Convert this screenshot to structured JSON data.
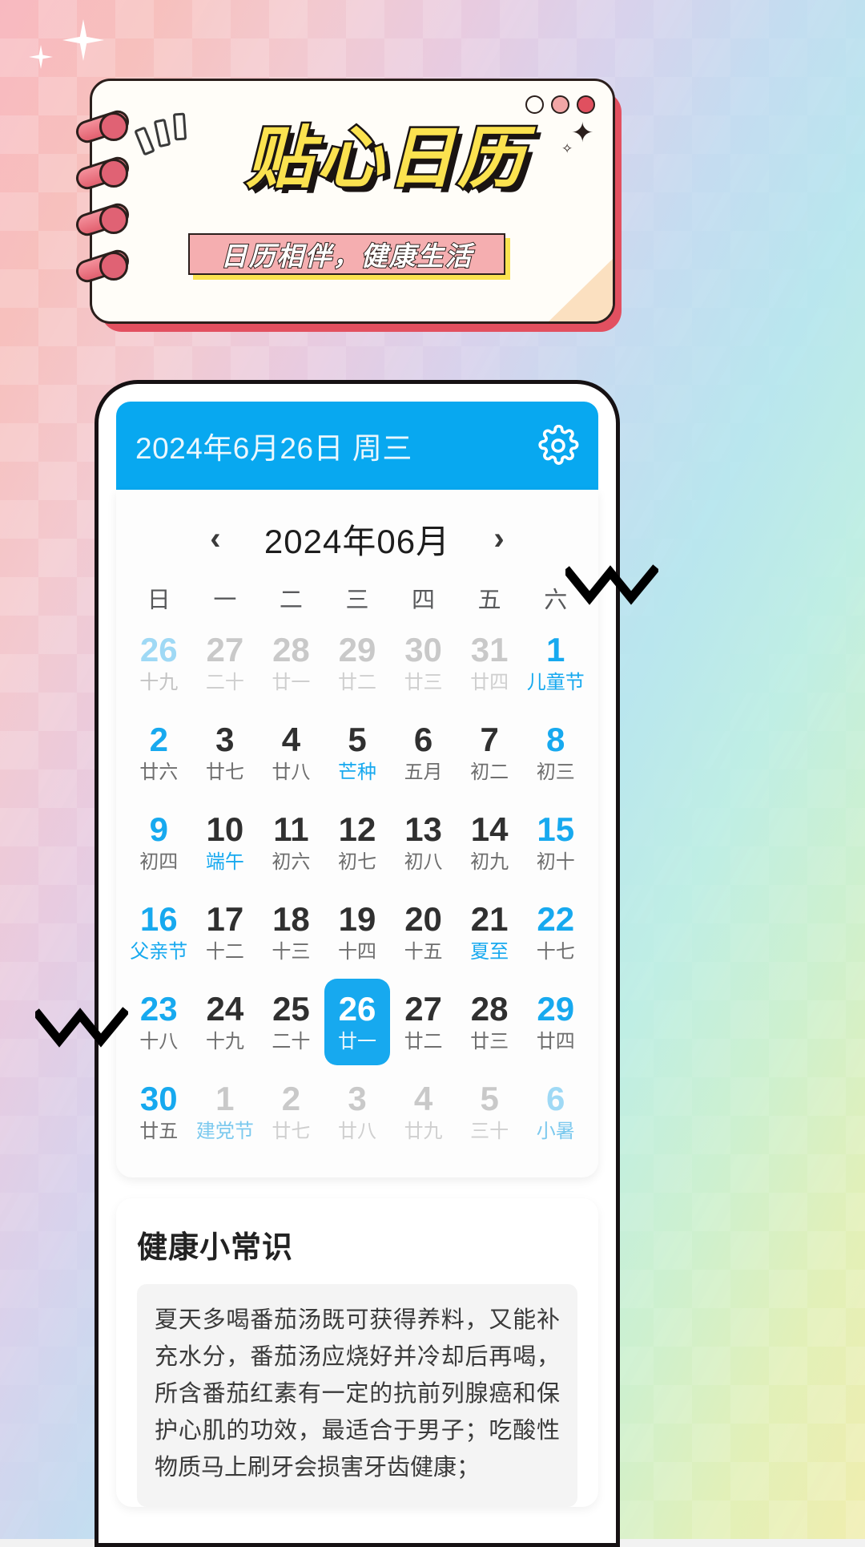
{
  "poster": {
    "title": "贴心日历",
    "subtitle": "日历相伴，健康生活",
    "dots": [
      "window-dot-1",
      "window-dot-2",
      "window-dot-3"
    ],
    "accent_yellow": "#FBE24F",
    "accent_pink": "#F5AEB0",
    "outline": "#2B1F1C"
  },
  "app": {
    "brand_blue": "#08A8F0",
    "header": {
      "date_text": "2024年6月26日 周三",
      "settings_icon": "gear-icon"
    },
    "calendar": {
      "prev_label": "‹",
      "next_label": "›",
      "month_label": "2024年06月",
      "weekdays": [
        "日",
        "一",
        "二",
        "三",
        "四",
        "五",
        "六"
      ],
      "selected_day": 26,
      "weeks": [
        [
          {
            "day": "26",
            "lunar": "十九",
            "state": "out",
            "blue": true
          },
          {
            "day": "27",
            "lunar": "二十",
            "state": "out"
          },
          {
            "day": "28",
            "lunar": "廿一",
            "state": "out"
          },
          {
            "day": "29",
            "lunar": "廿二",
            "state": "out"
          },
          {
            "day": "30",
            "lunar": "廿三",
            "state": "out"
          },
          {
            "day": "31",
            "lunar": "廿四",
            "state": "out"
          },
          {
            "day": "1",
            "lunar": "儿童节",
            "state": "in",
            "weekend": true,
            "festival": true
          }
        ],
        [
          {
            "day": "2",
            "lunar": "廿六",
            "state": "in",
            "weekend": true
          },
          {
            "day": "3",
            "lunar": "廿七",
            "state": "in"
          },
          {
            "day": "4",
            "lunar": "廿八",
            "state": "in"
          },
          {
            "day": "5",
            "lunar": "芒种",
            "state": "in",
            "festival": true
          },
          {
            "day": "6",
            "lunar": "五月",
            "state": "in"
          },
          {
            "day": "7",
            "lunar": "初二",
            "state": "in"
          },
          {
            "day": "8",
            "lunar": "初三",
            "state": "in",
            "weekend": true
          }
        ],
        [
          {
            "day": "9",
            "lunar": "初四",
            "state": "in",
            "weekend": true
          },
          {
            "day": "10",
            "lunar": "端午",
            "state": "in",
            "festival": true
          },
          {
            "day": "11",
            "lunar": "初六",
            "state": "in"
          },
          {
            "day": "12",
            "lunar": "初七",
            "state": "in"
          },
          {
            "day": "13",
            "lunar": "初八",
            "state": "in"
          },
          {
            "day": "14",
            "lunar": "初九",
            "state": "in"
          },
          {
            "day": "15",
            "lunar": "初十",
            "state": "in",
            "weekend": true
          }
        ],
        [
          {
            "day": "16",
            "lunar": "父亲节",
            "state": "in",
            "weekend": true,
            "festival": true
          },
          {
            "day": "17",
            "lunar": "十二",
            "state": "in"
          },
          {
            "day": "18",
            "lunar": "十三",
            "state": "in"
          },
          {
            "day": "19",
            "lunar": "十四",
            "state": "in"
          },
          {
            "day": "20",
            "lunar": "十五",
            "state": "in"
          },
          {
            "day": "21",
            "lunar": "夏至",
            "state": "in",
            "festival": true
          },
          {
            "day": "22",
            "lunar": "十七",
            "state": "in",
            "weekend": true
          }
        ],
        [
          {
            "day": "23",
            "lunar": "十八",
            "state": "in",
            "weekend": true
          },
          {
            "day": "24",
            "lunar": "十九",
            "state": "in"
          },
          {
            "day": "25",
            "lunar": "二十",
            "state": "in"
          },
          {
            "day": "26",
            "lunar": "廿一",
            "state": "in",
            "selected": true
          },
          {
            "day": "27",
            "lunar": "廿二",
            "state": "in"
          },
          {
            "day": "28",
            "lunar": "廿三",
            "state": "in"
          },
          {
            "day": "29",
            "lunar": "廿四",
            "state": "in",
            "weekend": true
          }
        ],
        [
          {
            "day": "30",
            "lunar": "廿五",
            "state": "in",
            "weekend": true
          },
          {
            "day": "1",
            "lunar": "建党节",
            "state": "out",
            "festival": true
          },
          {
            "day": "2",
            "lunar": "廿七",
            "state": "out"
          },
          {
            "day": "3",
            "lunar": "廿八",
            "state": "out"
          },
          {
            "day": "4",
            "lunar": "廿九",
            "state": "out"
          },
          {
            "day": "5",
            "lunar": "三十",
            "state": "out"
          },
          {
            "day": "6",
            "lunar": "小暑",
            "state": "out",
            "blue": true,
            "festival": true
          }
        ]
      ]
    },
    "tips": {
      "title": "健康小常识",
      "body": "夏天多喝番茄汤既可获得养料，又能补充水分，番茄汤应烧好并冷却后再喝，所含番茄红素有一定的抗前列腺癌和保护心肌的功效，最适合于男子；吃酸性物质马上刷牙会损害牙齿健康；"
    }
  }
}
